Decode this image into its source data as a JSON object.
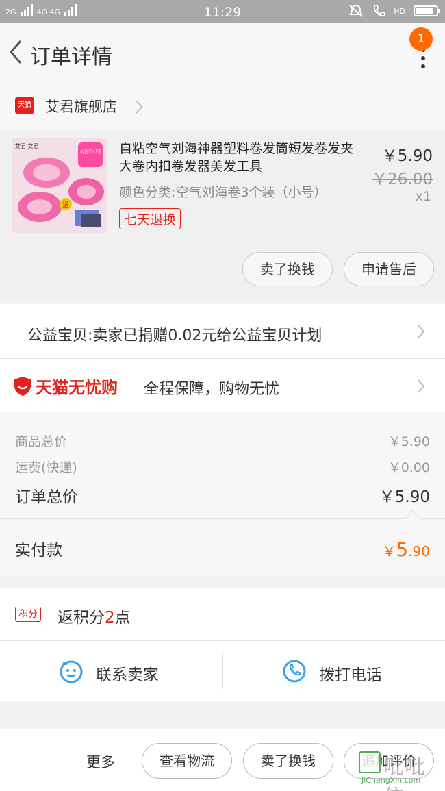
{
  "statusbar": {
    "net1": "2G",
    "net2": "4G 4G",
    "time": "11:29",
    "hd": "HD",
    "battery_level": 0.9
  },
  "header": {
    "title": "订单详情",
    "badge": "1"
  },
  "shop": {
    "name": "艾君旗舰店",
    "logo_text": "天猫"
  },
  "product": {
    "title": "自粘空气刘海神器塑料卷发筒短发卷发夹大卷内扣卷发器美发工具",
    "sku": "颜色分类:空气刘海卷3个装（小号）",
    "tag": "七天退换",
    "price": "￥5.90",
    "original_price": "￥26.00",
    "qty": "x1",
    "thumb_brand": "艾君·艾君",
    "thumb_size": "小号 直径2.5cm 3个装",
    "thumb_gift": "送",
    "actions": [
      "卖了换钱",
      "申请售后"
    ]
  },
  "charity": {
    "text": "公益宝贝:卖家已捐赠0.02元给公益宝贝计划"
  },
  "wuyou": {
    "logo": "天猫无忧购",
    "text": "全程保障，购物无忧"
  },
  "fees": {
    "goods_label": "商品总价",
    "goods_value": "￥5.90",
    "ship_label": "运费(快递)",
    "ship_value": "￥0.00",
    "total_label": "订单总价",
    "total_value": "￥5.90"
  },
  "paid": {
    "label": "实付款",
    "currency": "￥",
    "int": "5",
    "dec": ".90"
  },
  "points": {
    "tag": "积分",
    "prefix": "返积分",
    "num": "2",
    "suffix": "点"
  },
  "contact": {
    "seller": "联系卖家",
    "phone": "拨打电话"
  },
  "bottom": {
    "more": "更多",
    "buttons": [
      "查看物流",
      "卖了换钱",
      "追加评价"
    ]
  },
  "watermark": {
    "cn": "吡吡信",
    "en": "JiChengXin.com"
  },
  "colors": {
    "accent": "#ff6a00",
    "tmall_red": "#e2221b",
    "icon_blue": "#3aa0e8"
  }
}
